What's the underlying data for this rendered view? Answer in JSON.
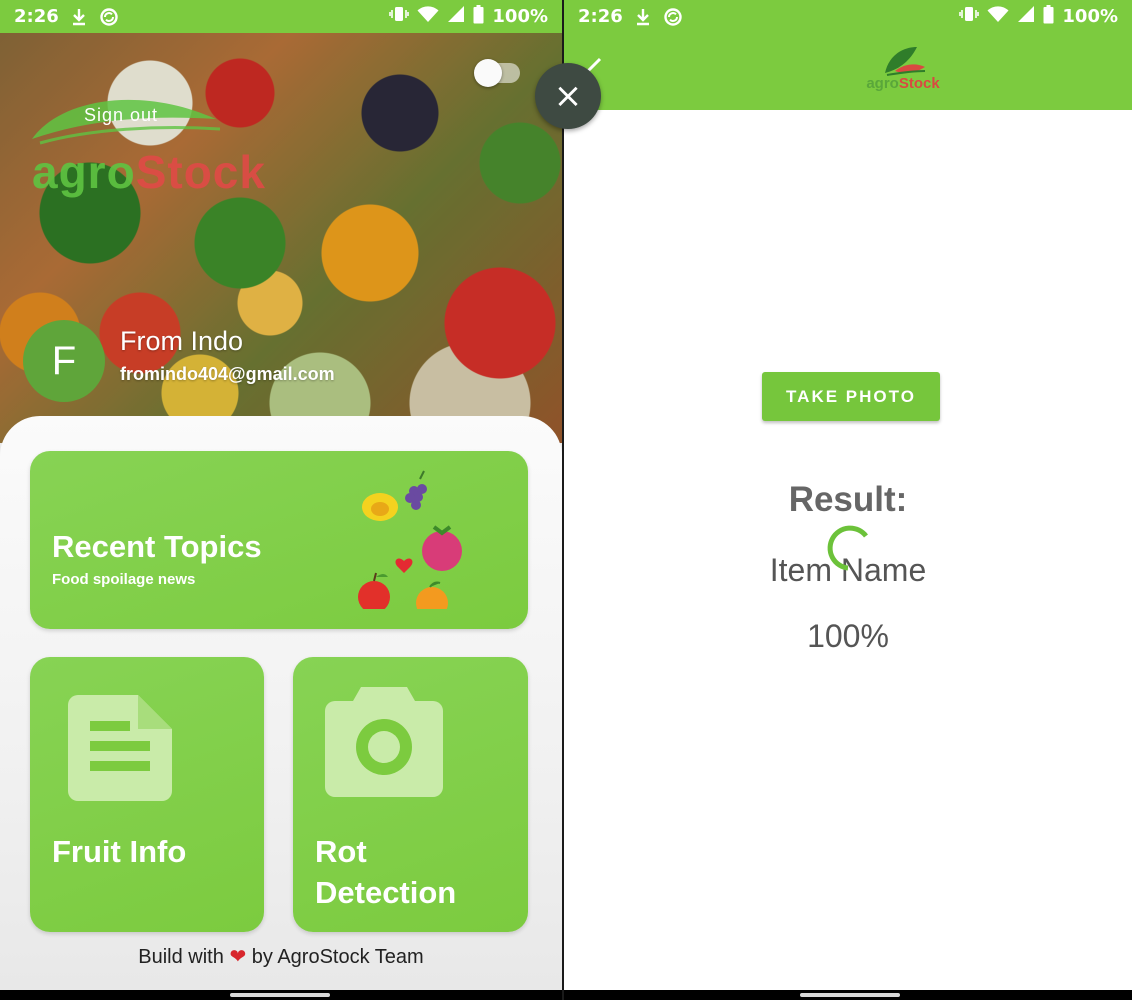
{
  "status_bar": {
    "time": "2:26",
    "battery": "100%"
  },
  "left_screen": {
    "header": {
      "sign_out_label": "Sign out",
      "logo": {
        "agro": "agro",
        "stock": "Stock"
      },
      "user": {
        "avatar_letter": "F",
        "name": "From Indo",
        "email": "fromindo404@gmail.com"
      }
    },
    "cards": {
      "recent": {
        "title": "Recent Topics",
        "subtitle": "Food spoilage news"
      },
      "fruit_info": {
        "label": "Fruit Info"
      },
      "rot_detection": {
        "label_line1": "Rot",
        "label_line2": "Detection"
      }
    },
    "footer": {
      "prefix": "Build with",
      "heart": "❤",
      "suffix": "by AgroStock Team"
    }
  },
  "right_screen": {
    "app_bar": {
      "logo": {
        "agro": "agro",
        "stock": "Stock"
      }
    },
    "close_icon": "×",
    "take_photo_label": "TAKE PHOTO",
    "result_label": "Result:",
    "item_name": "Item Name",
    "percent": "100%"
  },
  "colors": {
    "primary": "#7ccb3f",
    "accent_red": "#e04a46",
    "fab": "#3e4a42"
  },
  "icons": [
    "download-icon",
    "sync-icon",
    "vibrate-icon",
    "wifi-icon",
    "signal-icon",
    "battery-icon",
    "close-icon",
    "document-icon",
    "camera-icon",
    "heart-icon"
  ]
}
